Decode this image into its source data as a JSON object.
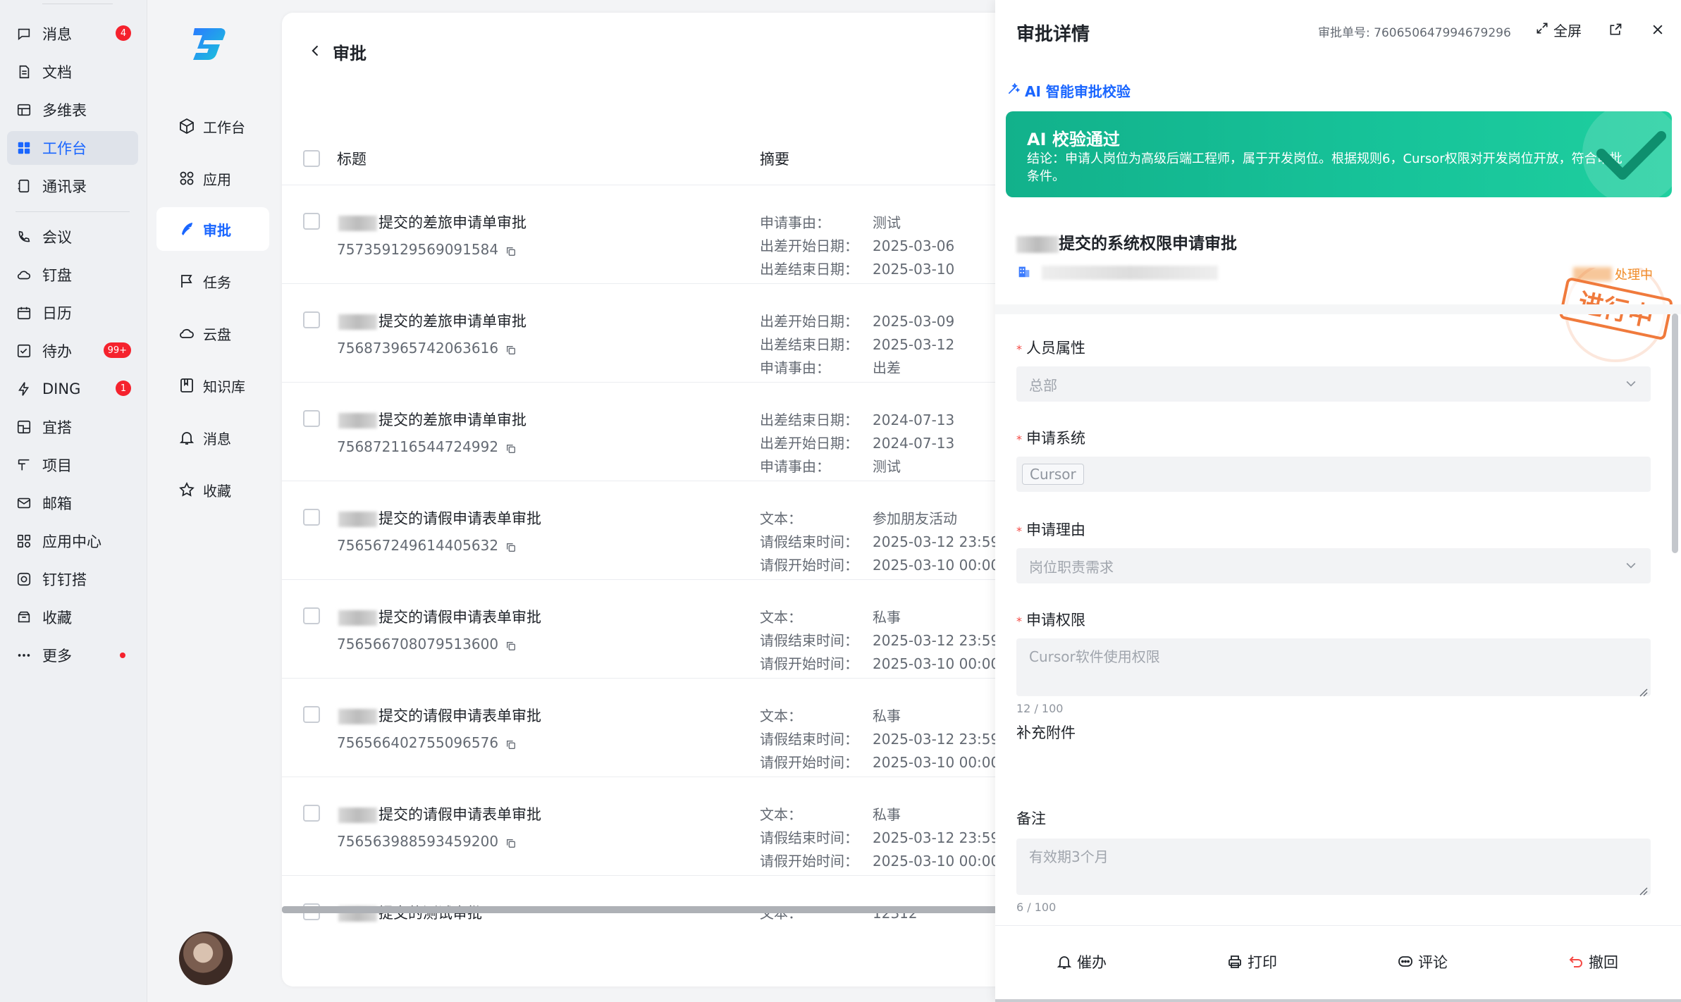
{
  "app_nav": {
    "items": [
      {
        "label": "消息",
        "badge": "4",
        "icon": "chat-bubble-icon"
      },
      {
        "label": "文档",
        "icon": "document-icon"
      },
      {
        "label": "多维表",
        "icon": "table-icon"
      },
      {
        "label": "工作台",
        "icon": "grid-icon",
        "active": true
      },
      {
        "label": "通讯录",
        "icon": "contacts-icon"
      },
      {
        "label": "会议",
        "icon": "phone-icon"
      },
      {
        "label": "钉盘",
        "icon": "cloud-icon"
      },
      {
        "label": "日历",
        "icon": "calendar-icon"
      },
      {
        "label": "待办",
        "badge": "99+",
        "icon": "todo-icon"
      },
      {
        "label": "DING",
        "badge": "1",
        "icon": "lightning-icon"
      },
      {
        "label": "宜搭",
        "icon": "build-icon"
      },
      {
        "label": "项目",
        "icon": "project-icon"
      },
      {
        "label": "邮箱",
        "icon": "mail-icon"
      },
      {
        "label": "应用中心",
        "icon": "apps-icon"
      },
      {
        "label": "钉钉搭",
        "icon": "ding-build-icon"
      },
      {
        "label": "收藏",
        "icon": "favorite-box-icon"
      },
      {
        "label": "更多",
        "icon": "more-icon"
      }
    ]
  },
  "sub_nav": {
    "items": [
      {
        "label": "工作台"
      },
      {
        "label": "应用"
      },
      {
        "label": "审批",
        "active": true
      },
      {
        "label": "任务"
      },
      {
        "label": "云盘"
      },
      {
        "label": "知识库"
      },
      {
        "label": "消息"
      },
      {
        "label": "收藏"
      }
    ]
  },
  "list": {
    "title": "审批",
    "col_title": "标题",
    "col_summary": "摘要",
    "rows": [
      {
        "title_suffix": "提交的差旅申请单审批",
        "id": "757359129569091584",
        "summary": [
          [
            "申请事由：",
            "测试"
          ],
          [
            "出差开始日期：",
            "2025-03-06"
          ],
          [
            "出差结束日期：",
            "2025-03-10"
          ]
        ]
      },
      {
        "title_suffix": "提交的差旅申请单审批",
        "id": "756873965742063616",
        "summary": [
          [
            "出差开始日期：",
            "2025-03-09"
          ],
          [
            "出差结束日期：",
            "2025-03-12"
          ],
          [
            "申请事由：",
            "出差"
          ]
        ]
      },
      {
        "title_suffix": "提交的差旅申请单审批",
        "id": "756872116544724992",
        "summary": [
          [
            "出差结束日期：",
            "2024-07-13"
          ],
          [
            "出差开始日期：",
            "2024-07-13"
          ],
          [
            "申请事由：",
            "测试"
          ]
        ]
      },
      {
        "title_suffix": "提交的请假申请表单审批",
        "id": "756567249614405632",
        "summary": [
          [
            "文本：",
            "参加朋友活动"
          ],
          [
            "请假结束时间：",
            "2025-03-12 23:59:"
          ],
          [
            "请假开始时间：",
            "2025-03-10 00:00:"
          ]
        ]
      },
      {
        "title_suffix": "提交的请假申请表单审批",
        "id": "756566708079513600",
        "summary": [
          [
            "文本：",
            "私事"
          ],
          [
            "请假结束时间：",
            "2025-03-12 23:59:"
          ],
          [
            "请假开始时间：",
            "2025-03-10 00:00:"
          ]
        ]
      },
      {
        "title_suffix": "提交的请假申请表单审批",
        "id": "756566402755096576",
        "summary": [
          [
            "文本：",
            "私事"
          ],
          [
            "请假结束时间：",
            "2025-03-12 23:59:"
          ],
          [
            "请假开始时间：",
            "2025-03-10 00:00:"
          ]
        ]
      },
      {
        "title_suffix": "提交的请假申请表单审批",
        "id": "756563988593459200",
        "summary": [
          [
            "文本：",
            "私事"
          ],
          [
            "请假结束时间：",
            "2025-03-12 23:59:"
          ],
          [
            "请假开始时间：",
            "2025-03-10 00:00:"
          ]
        ]
      },
      {
        "title_suffix": "提交的测试审批",
        "id": "",
        "summary": [
          [
            "文本：",
            "12312"
          ]
        ]
      }
    ]
  },
  "drawer": {
    "title": "审批详情",
    "approval_no": "审批单号: 760650647994679296",
    "fullscreen_label": "全屏",
    "ai_link": "AI 智能审批校验",
    "ai_result_title": "AI 校验通过",
    "ai_result_desc": "结论：申请人岗位为高级后端工程师，属于开发岗位。根据规则6，Cursor权限对开发岗位开放，符合审批条件。",
    "form_title_suffix": "提交的系统权限申请审批",
    "status": "处理中",
    "stamp_text": "进行中",
    "fields": {
      "personnel_label": "人员属性",
      "personnel_value": "总部",
      "system_label": "申请系统",
      "system_value": "Cursor",
      "reason_label": "申请理由",
      "reason_value": "岗位职责需求",
      "permission_label": "申请权限",
      "permission_value": "Cursor软件使用权限",
      "permission_count": "12 / 100",
      "attachment_label": "补充附件",
      "remark_label": "备注",
      "remark_value": "有效期3个月",
      "remark_count": "6 / 100"
    },
    "actions": {
      "urge": "催办",
      "print": "打印",
      "comment": "评论",
      "revoke": "撤回"
    }
  },
  "colors": {
    "accent": "#1a66ff",
    "success_card": "#17c49a",
    "badge": "#f5222d",
    "status": "#f08a24",
    "required": "#f54a45"
  }
}
